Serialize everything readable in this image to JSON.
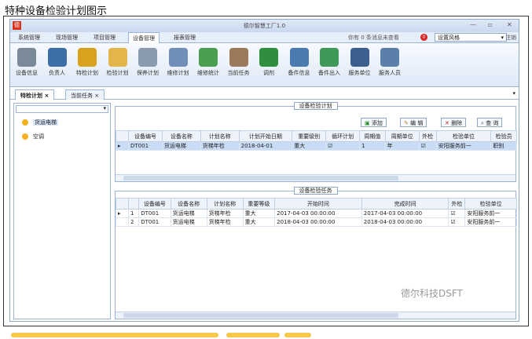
{
  "caption": "特种设备检验计划图示",
  "window": {
    "title": "德尔智慧工厂1.0",
    "min": "—",
    "max": "▫",
    "close": "✕"
  },
  "menu": {
    "items": [
      "系统管理",
      "现场管理",
      "项目管理",
      "设备管理",
      "报表管理"
    ],
    "active_index": 3,
    "notice": "你有 0 条消息未查看",
    "notice_count": "0",
    "skin_value": "设置风格",
    "logout": "注销"
  },
  "ribbon": [
    {
      "label": "设备信息",
      "icon": "gear-icon",
      "color": "#7a8a99"
    },
    {
      "label": "负责人",
      "icon": "users-icon",
      "color": "#3d6fa6"
    },
    {
      "label": "特检计划",
      "icon": "coins-clock-icon",
      "color": "#d9a21d"
    },
    {
      "label": "检验计划",
      "icon": "folder-clock-icon",
      "color": "#e2b64a"
    },
    {
      "label": "保养计划",
      "icon": "clock-icon",
      "color": "#8a9bb0"
    },
    {
      "label": "维修计划",
      "icon": "calendar-clock-icon",
      "color": "#6f8fb8"
    },
    {
      "label": "维修统计",
      "icon": "bar-chart-icon",
      "color": "#4aa050"
    },
    {
      "label": "当前任务",
      "icon": "clipboard-icon",
      "color": "#9a7a5a"
    },
    {
      "label": "调剂",
      "icon": "add-transfer-icon",
      "color": "#2f8f3f"
    },
    {
      "label": "备件信息",
      "icon": "tools-icon",
      "color": "#4a7ab0"
    },
    {
      "label": "备件出入",
      "icon": "database-refresh-icon",
      "color": "#3f9a5a"
    },
    {
      "label": "服务单位",
      "icon": "server-icon",
      "color": "#3b5f8f"
    },
    {
      "label": "服务人员",
      "icon": "person-icon",
      "color": "#5a7fa8"
    }
  ],
  "doc_tabs": [
    {
      "label": "特检计划",
      "close": "×"
    },
    {
      "label": "当前任务",
      "close": "×"
    }
  ],
  "tree": {
    "items": [
      "货运电梯",
      "空调"
    ]
  },
  "plan": {
    "title": "设备检验计划",
    "buttons": [
      {
        "label": "添加",
        "icon": "add-icon"
      },
      {
        "label": "编 辑",
        "icon": "edit-icon"
      },
      {
        "label": "删除",
        "icon": "delete-icon"
      },
      {
        "label": "查 询",
        "icon": "search-icon"
      }
    ],
    "columns": [
      "设备编号",
      "设备名称",
      "计划名称",
      "计划开始日期",
      "重要级别",
      "循环计划",
      "周期值",
      "周期单位",
      "外检",
      "检验单位",
      "检验员"
    ],
    "rows": [
      [
        "DT001",
        "货运电梯",
        "货梯年检",
        "2018-04-01",
        "重大",
        "☑",
        "1",
        "年",
        "☑",
        "安阳服务前一",
        "职别"
      ]
    ]
  },
  "tasks": {
    "title": "设备检验任务",
    "columns": [
      "设备编号",
      "设备名称",
      "计划名称",
      "重要等级",
      "开始时间",
      "完成时间",
      "外检",
      "检验单位"
    ],
    "rows": [
      [
        "1",
        "DT001",
        "货运电梯",
        "货梯年检",
        "重大",
        "2017-04-03 00:00:00",
        "2017-04-03 00:00:00",
        "☑",
        "安阳服务前一"
      ],
      [
        "2",
        "DT001",
        "货运电梯",
        "货梯年检",
        "重大",
        "2018-04-03 00:00:00",
        "2018-04-03 00:00:00",
        "☑",
        "安阳服务前一"
      ]
    ]
  },
  "watermark": "德尔科技DSFT"
}
